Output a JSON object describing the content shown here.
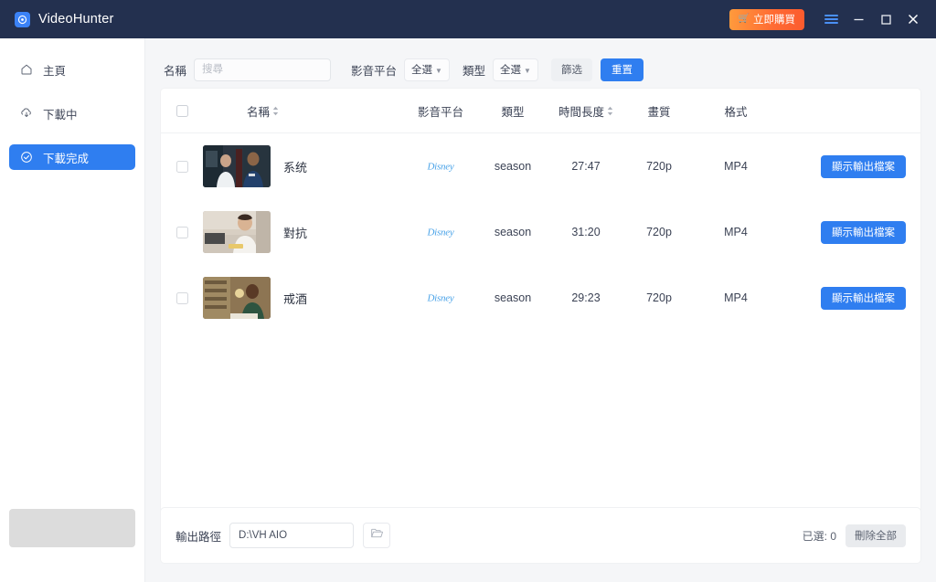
{
  "app": {
    "name": "VideoHunter",
    "icon": "app-logo-icon"
  },
  "titlebar": {
    "buy_label": "立即購買",
    "cart_icon": "cart-icon",
    "menu_icon": "hamburger-menu-icon",
    "minimize_icon": "minimize-icon",
    "maximize_icon": "maximize-icon",
    "close_icon": "close-icon"
  },
  "sidebar": {
    "items": [
      {
        "label": "主頁",
        "icon": "home-icon",
        "active": false
      },
      {
        "label": "下載中",
        "icon": "download-icon",
        "active": false
      },
      {
        "label": "下載完成",
        "icon": "check-circle-icon",
        "active": true
      }
    ]
  },
  "filter": {
    "name_label": "名稱",
    "search_placeholder": "搜尋",
    "search_value": "",
    "platform_label": "影音平台",
    "platform_value": "全選",
    "type_label": "類型",
    "type_value": "全選",
    "filter_button": "篩选",
    "reset_button": "重置",
    "chevron_icon": "chevron-down-icon"
  },
  "table": {
    "headers": {
      "name": "名稱",
      "platform": "影音平台",
      "type": "類型",
      "duration": "時間長度",
      "quality": "畫質",
      "format": "格式"
    },
    "rows": [
      {
        "name": "系统",
        "platform": "Disney+",
        "type": "season",
        "duration": "27:47",
        "quality": "720p",
        "format": "MP4",
        "action": "顯示輸出檔案",
        "thumbnail": "two-people-dark-industrial"
      },
      {
        "name": "對抗",
        "platform": "Disney+",
        "type": "season",
        "duration": "31:20",
        "quality": "720p",
        "format": "MP4",
        "action": "顯示輸出檔案",
        "thumbnail": "person-bright-kitchen"
      },
      {
        "name": "戒酒",
        "platform": "Disney+",
        "type": "season",
        "duration": "29:23",
        "quality": "720p",
        "format": "MP4",
        "action": "顯示輸出檔案",
        "thumbnail": "person-green-shirt-indoor"
      }
    ]
  },
  "bottom": {
    "path_label": "輸出路徑",
    "path_value": "D:\\VH AIO",
    "folder_icon": "folder-open-icon",
    "selected_label": "已選: 0",
    "delete_all": "刪除全部"
  },
  "colors": {
    "titlebar_bg": "#23304f",
    "accent_blue": "#2f7ef0",
    "buy_orange": "#ff6a33",
    "page_bg": "#f5f6f8",
    "disney_blue": "#4aa3e8"
  }
}
